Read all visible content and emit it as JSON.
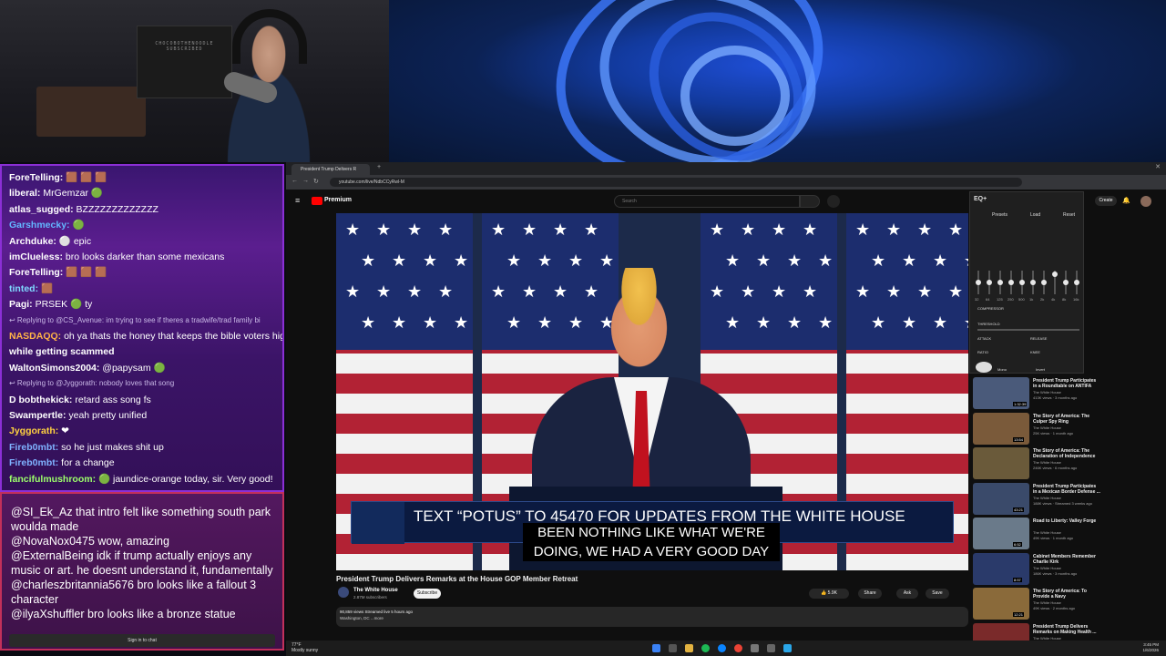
{
  "chat_top": [
    {
      "user": "ForeTelling:",
      "text": " 🟫 🟫 🟫",
      "color": "#ffffff"
    },
    {
      "user": "liberal:",
      "text": " MrGemzar 🟢",
      "color": "#ffffff"
    },
    {
      "user": "atlas_sugged:",
      "text": " BZZZZZZZZZZZZZ",
      "color": "#ffffff"
    },
    {
      "user": "Garshmecky:",
      "text": " 🟢",
      "color": "#63b6ff"
    },
    {
      "user": "Archduke:",
      "text": " ⚪ epic",
      "color": "#ffffff"
    },
    {
      "user": "imClueless:",
      "text": " bro looks darker than some mexicans",
      "color": "#ffffff"
    },
    {
      "user": "ForeTelling:",
      "text": " 🟫 🟫 🟫",
      "color": "#ffffff"
    },
    {
      "user": "tinted:",
      "text": " 🟫",
      "color": "#7fd8ff"
    },
    {
      "user": "Pagi:",
      "text": " PRSEK 🟢 ty",
      "color": "#ffffff"
    },
    {
      "user": "",
      "text": "↩ Replying to @CS_Avenue: im trying to see if theres a tradwife/trad family bi",
      "color": "#c9b8e6",
      "small": true
    },
    {
      "user": "NASDAQQ:",
      "text": " oh ya thats the honey that keeps the bible voters hig",
      "color": "#ffb347"
    },
    {
      "user": "",
      "text": "while getting scammed",
      "color": "#ffffff",
      "bold": true
    },
    {
      "user": "WaltonSimons2004:",
      "text": " @papysam 🟢",
      "color": "#ffffff"
    },
    {
      "user": "",
      "text": "↩ Replying to @Jyggorath: nobody loves that song",
      "color": "#c9b8e6",
      "small": true
    },
    {
      "user": "D bobthekick:",
      "text": " retard ass song fs",
      "color": "#ffffff"
    },
    {
      "user": "Swampertle:",
      "text": " yeah pretty unified",
      "color": "#ffffff"
    },
    {
      "user": "Jyggorath:",
      "text": " ❤",
      "color": "#ffd23f"
    },
    {
      "user": "Fireb0mbt:",
      "text": " so he just makes shit up",
      "color": "#7fb2ff"
    },
    {
      "user": "Fireb0mbt:",
      "text": " for a change",
      "color": "#7fb2ff"
    },
    {
      "user": "fancifulmushroom:",
      "text": " 🟢 jaundice-orange today, sir. Very good!",
      "color": "#9cff6b"
    }
  ],
  "chat_bottom": [
    {
      "user": "@SI_Ek_Az",
      "text": " that intro felt like something south park woulda made"
    },
    {
      "user": "@NovaNox0475",
      "text": " wow, amazing"
    },
    {
      "user": "@ExternalBeing",
      "text": " idk if trump actually enjoys any music or art. he doesnt understand it, fundamentally"
    },
    {
      "user": "@charleszbritannia5676",
      "text": " bro looks like a fallout 3 character"
    },
    {
      "user": "@ilyaXshuffler",
      "text": " bro looks like a bronze statue"
    }
  ],
  "signin": "Sign in to chat",
  "webcam": {
    "sign_text": "CHOCOBOTHENOODLE SUBSCRIBED"
  },
  "browser": {
    "tab_title": "President Trump Delivers R",
    "url": "youtube.com/live/NdbCCyRwl-M"
  },
  "youtube": {
    "logo": "Premium",
    "search_placeholder": "Search",
    "create": "Create",
    "lower_third": "TEXT “POTUS” TO 45470 FOR UPDATES FROM THE WHITE HOUSE",
    "caption_line1": "BEEN NOTHING LIKE WHAT WE'RE",
    "caption_line2": "DOING, WE HAD A VERY GOOD DAY",
    "title": "President Trump Delivers Remarks at the House GOP Member Retreat",
    "channel": "The White House",
    "subs": "2.87M subscribers",
    "subscribe": "Subscribe",
    "likes": "5.9K",
    "share": "Share",
    "ask": "Ask",
    "save": "Save",
    "views_line": "90,859 views  Streamed live 5 hours ago",
    "location_line": "Washington, DC  ...more"
  },
  "eq": {
    "title": "EQ+",
    "presets": "Presets",
    "load": "Load",
    "reset": "Reset",
    "compressor": "COMPRESSOR",
    "threshold": "THRESHOLD",
    "attack": "ATTACK",
    "release": "RELEASE",
    "ratio": "RATIO",
    "knee": "KNEE",
    "pan": "Pan",
    "mono": "Mono",
    "invert": "Invert",
    "volume": "100%",
    "bands": [
      "32",
      "64",
      "125",
      "250",
      "500",
      "1k",
      "2k",
      "4k",
      "8k",
      "16k"
    ],
    "levels": [
      0.5,
      0.5,
      0.5,
      0.5,
      0.5,
      0.5,
      0.5,
      0.15,
      0.5,
      0.5
    ]
  },
  "recommendations": [
    {
      "title": "President Trump Participates in a Roundtable on ANTIFA",
      "channel": "The White House",
      "views": "413K views · 3 months ago",
      "duration": "1:32:39",
      "color": "#4a5a7a"
    },
    {
      "title": "The Story of America: The Culper Spy Ring",
      "channel": "The White House",
      "views": "25K views · 1 month ago",
      "duration": "13:54",
      "color": "#7a5a3a"
    },
    {
      "title": "The Story of America: The Declaration of Independence",
      "channel": "The White House",
      "views": "246K views · 6 months ago",
      "duration": "",
      "color": "#6a5a3a"
    },
    {
      "title": "President Trump Participates in a Mexican Border Defense ...",
      "channel": "The White House",
      "views": "188K views · Streamed 3 weeks ago",
      "duration": "43:21",
      "color": "#3a4a6a"
    },
    {
      "title": "Road to Liberty: Valley Forge",
      "channel": "The White House",
      "views": "49K views · 1 month ago",
      "duration": "6:52",
      "color": "#6a7a8a"
    },
    {
      "title": "Cabinet Members Remember Charlie Kirk",
      "channel": "The White House",
      "views": "186K views · 3 months ago",
      "duration": "8:57",
      "color": "#2a3a6a"
    },
    {
      "title": "The Story of America: To Provide a Navy",
      "channel": "The White House",
      "views": "49K views · 2 months ago",
      "duration": "12:21",
      "color": "#8a6a3a"
    },
    {
      "title": "President Trump Delivers Remarks on Making Health ...",
      "channel": "The White House",
      "views": "",
      "duration": "",
      "color": "#7a2a2a"
    }
  ],
  "taskbar": {
    "weather_temp": "77°F",
    "weather_desc": "Mostly sunny",
    "time": "3:45 PM",
    "date": "1/6/2026"
  }
}
